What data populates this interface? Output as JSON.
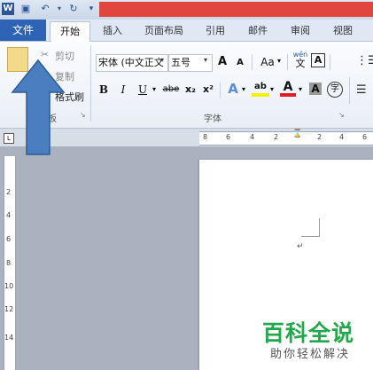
{
  "quick_access": {
    "word_icon": "word-icon",
    "save_icon": "save-icon",
    "undo_icon": "undo-icon",
    "redo_icon": "redo-icon",
    "customize_icon": "customize-arrow-icon"
  },
  "tabs": {
    "file": "文件",
    "home": "开始",
    "insert": "插入",
    "page_layout": "页面布局",
    "references": "引用",
    "mailings": "邮件",
    "review": "审阅",
    "view": "视图"
  },
  "clipboard": {
    "cut": "剪切",
    "copy": "复制",
    "format_painter": "格式刷",
    "group_label": "剪贴板",
    "visible_group_label": "贴板"
  },
  "font": {
    "font_name": "宋体 (中文正文",
    "font_size": "五号",
    "grow": "A",
    "shrink": "A",
    "change_case": "Aa",
    "bold": "B",
    "italic": "I",
    "underline": "U",
    "strikethrough": "abe",
    "subscript": "x₂",
    "superscript": "x²",
    "text_effect": "A",
    "highlight": "ab",
    "font_color": "A",
    "char_shading": "A",
    "enclose": "字",
    "group_label": "字体",
    "wen": "wén",
    "wen_char": "文",
    "border_char": "A"
  },
  "ruler": {
    "top_numbers": [
      "8",
      "6",
      "4",
      "2",
      "2",
      "4",
      "6"
    ],
    "left_numbers": [
      "2",
      "4",
      "6",
      "8",
      "10",
      "12",
      "14"
    ]
  },
  "watermark": {
    "title": "百科全说",
    "subtitle": "助你轻松解决"
  },
  "colors": {
    "file_tab": "#2f63b5",
    "title_red": "#e0463e",
    "arrow": "#4a7ec0",
    "watermark": "#22a84a"
  }
}
